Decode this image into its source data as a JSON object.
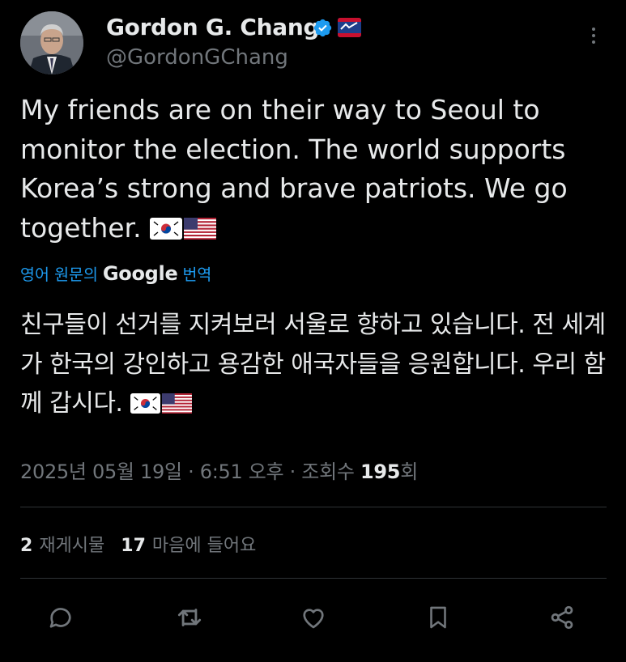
{
  "author": {
    "name": "Gordon G. Chang",
    "handle": "@GordonGChang",
    "verified": true,
    "verified_color": "#1d9bf0"
  },
  "tweet": {
    "text_en": "My friends are on their way to Seoul to monitor the election. The world supports Korea’s strong and brave patriots. We go together.",
    "translate_prefix": "영어 원문의",
    "translate_brand": "Google",
    "translate_suffix": "번역",
    "text_ko": "친구들이 선거를 지켜보러 서울로 향하고 있습니다. 전 세계가 한국의 강인하고 용감한 애국자들을 응원합니다. 우리 함께 갑시다.",
    "flags": [
      "south-korea-flag",
      "us-flag"
    ]
  },
  "meta": {
    "datetime": "2025년 05월 19일 · 6:51 오후 · 조회수",
    "views": "195",
    "views_suffix": "회"
  },
  "stats": {
    "reposts_count": "2",
    "reposts_label": "재게시물",
    "likes_count": "17",
    "likes_label": "마음에 들어요"
  },
  "actions": [
    "reply-icon",
    "retweet-icon",
    "like-icon",
    "bookmark-icon",
    "share-icon"
  ],
  "colors": {
    "background": "#000000",
    "text": "#e7e9ea",
    "muted": "#71767b",
    "link": "#1d9bf0",
    "divider": "#2f3336"
  }
}
